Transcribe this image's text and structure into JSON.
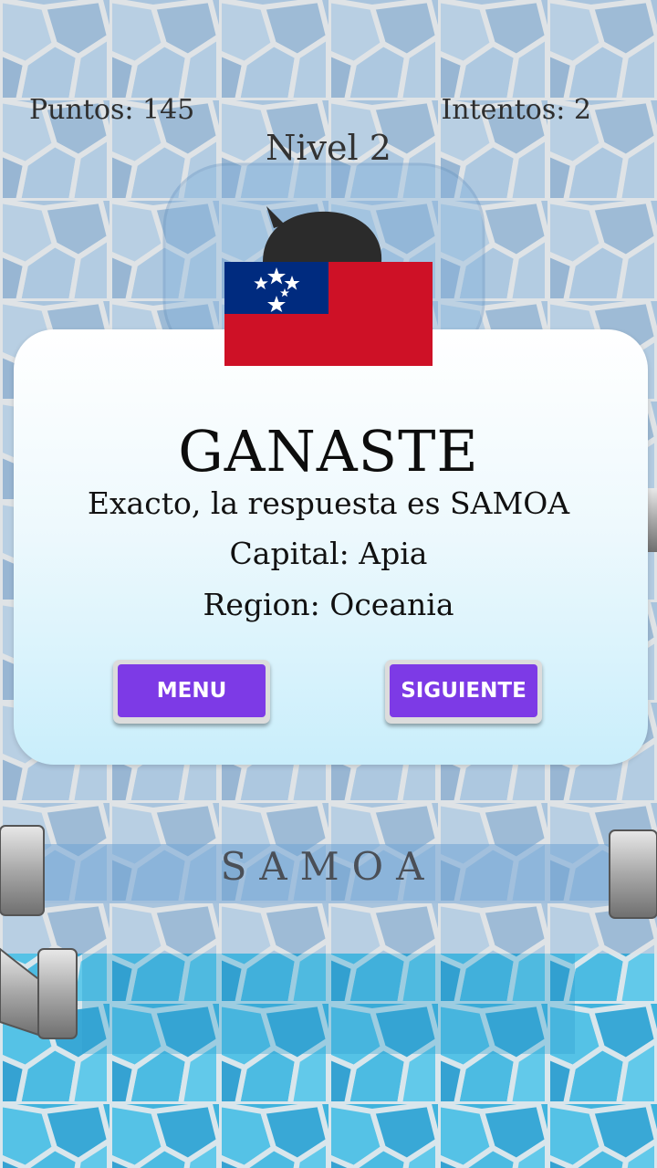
{
  "hud": {
    "score": "Puntos: 145",
    "tries": "Intentos: 2",
    "level": "Nivel 2"
  },
  "result": {
    "title": "GANASTE",
    "message": "Exacto, la respuesta es SAMOA",
    "capital": "Capital: Apia",
    "region": "Region: Oceania"
  },
  "buttons": {
    "menu": "MENU",
    "next": "SIGUIENTE"
  },
  "answer": "SAMOA",
  "flag": {
    "country": "Samoa",
    "icon": "samoa-flag",
    "colors": {
      "red": "#ce1126",
      "blue": "#002b7f",
      "star": "#ffffff"
    }
  },
  "colors": {
    "button": "#7d3ae6",
    "dialog_top": "#ffffff",
    "dialog_bottom": "#c9eefb"
  }
}
